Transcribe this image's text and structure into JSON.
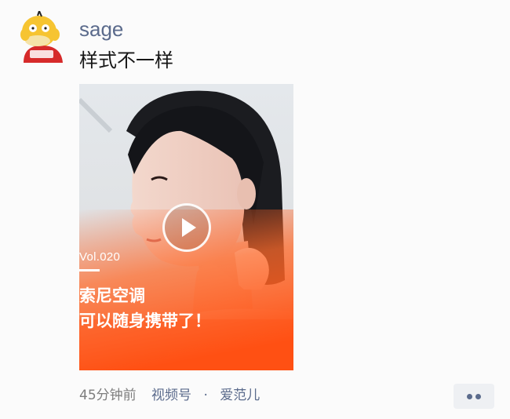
{
  "post": {
    "username": "sage",
    "text": "样式不一样"
  },
  "video": {
    "volume_label": "Vol.020",
    "headline_line1": "索尼空调",
    "headline_line2": "可以随身携带了！",
    "play_icon": "play-icon"
  },
  "meta": {
    "time": "45分钟前",
    "channel": "视频号",
    "separator": "·",
    "author": "爱范儿"
  },
  "more_button": {
    "icon": "more-dots-icon"
  },
  "colors": {
    "username": "#5b6b8c",
    "accent_orange": "#ff5a1f",
    "meta_gray": "#7d7d7d"
  }
}
